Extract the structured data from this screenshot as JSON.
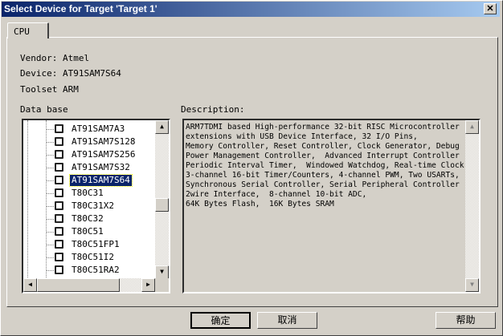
{
  "window": {
    "title": "Select Device for Target 'Target 1'",
    "close_icon": "close-icon"
  },
  "tabs": [
    {
      "label": "CPU"
    }
  ],
  "info": {
    "vendor_label": "Vendor:",
    "vendor": "Atmel",
    "device_label": "Device:",
    "device": "AT91SAM7S64",
    "toolset_label": "Toolset",
    "toolset": "ARM"
  },
  "database": {
    "label": "Data base",
    "items": [
      "AT91SAM7A3",
      "AT91SAM7S128",
      "AT91SAM7S256",
      "AT91SAM7S32",
      "AT91SAM7S64",
      "T80C31",
      "T80C31X2",
      "T80C32",
      "T80C51",
      "T80C51FP1",
      "T80C51I2",
      "T80C51RA2"
    ],
    "selected": "AT91SAM7S64"
  },
  "description": {
    "label": "Description:",
    "text": "ARM7TDMI based High-performance 32-bit RISC Microcontroller\nextensions with USB Device Interface, 32 I/O Pins,\nMemory Controller, Reset Controller, Clock Generator, Debug\nPower Management Controller,  Advanced Interrupt Controller\nPeriodic Interval Timer,  Windowed Watchdog, Real-time Clock\n3-channel 16-bit Timer/Counters, 4-channel PWM, Two USARTs,\nSynchronous Serial Controller, Serial Peripheral Controller\n2wire Interface,  8-channel 10-bit ADC,\n64K Bytes Flash,  16K Bytes SRAM"
  },
  "buttons": {
    "ok": "确定",
    "cancel": "取消",
    "help": "帮助"
  }
}
